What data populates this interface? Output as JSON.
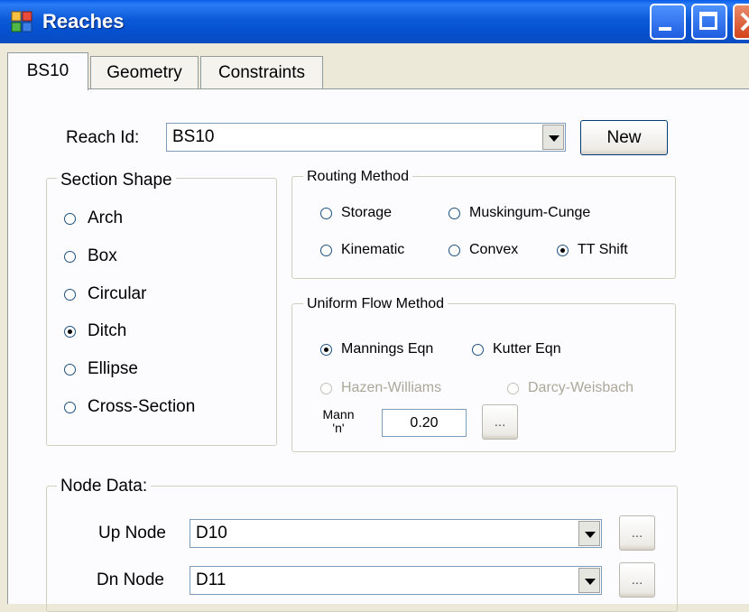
{
  "window": {
    "title": "Reaches"
  },
  "tabs": [
    {
      "label": "BS10",
      "active": true
    },
    {
      "label": "Geometry",
      "active": false
    },
    {
      "label": "Constraints",
      "active": false
    }
  ],
  "reach": {
    "label": "Reach Id:",
    "value": "BS10",
    "new_button": "New"
  },
  "section_shape": {
    "legend": "Section Shape",
    "options": [
      "Arch",
      "Box",
      "Circular",
      "Ditch",
      "Ellipse",
      "Cross-Section"
    ],
    "selected": "Ditch"
  },
  "routing_method": {
    "legend": "Routing Method",
    "options": [
      "Storage",
      "Muskingum-Cunge",
      "Kinematic",
      "Convex",
      "TT Shift"
    ],
    "selected": "TT Shift"
  },
  "uniform_flow": {
    "legend": "Uniform Flow Method",
    "options": [
      "Mannings Eqn",
      "Kutter Eqn",
      "Hazen-Williams",
      "Darcy-Weisbach"
    ],
    "selected": "Mannings Eqn",
    "disabled": [
      "Hazen-Williams",
      "Darcy-Weisbach"
    ],
    "mann_label_line1": "Mann",
    "mann_label_line2": "'n'",
    "mann_value": "0.20",
    "browse_label": "..."
  },
  "node_data": {
    "legend": "Node Data:",
    "up_label": "Up Node",
    "up_value": "D10",
    "dn_label": "Dn Node",
    "dn_value": "D11",
    "browse_label": "..."
  }
}
